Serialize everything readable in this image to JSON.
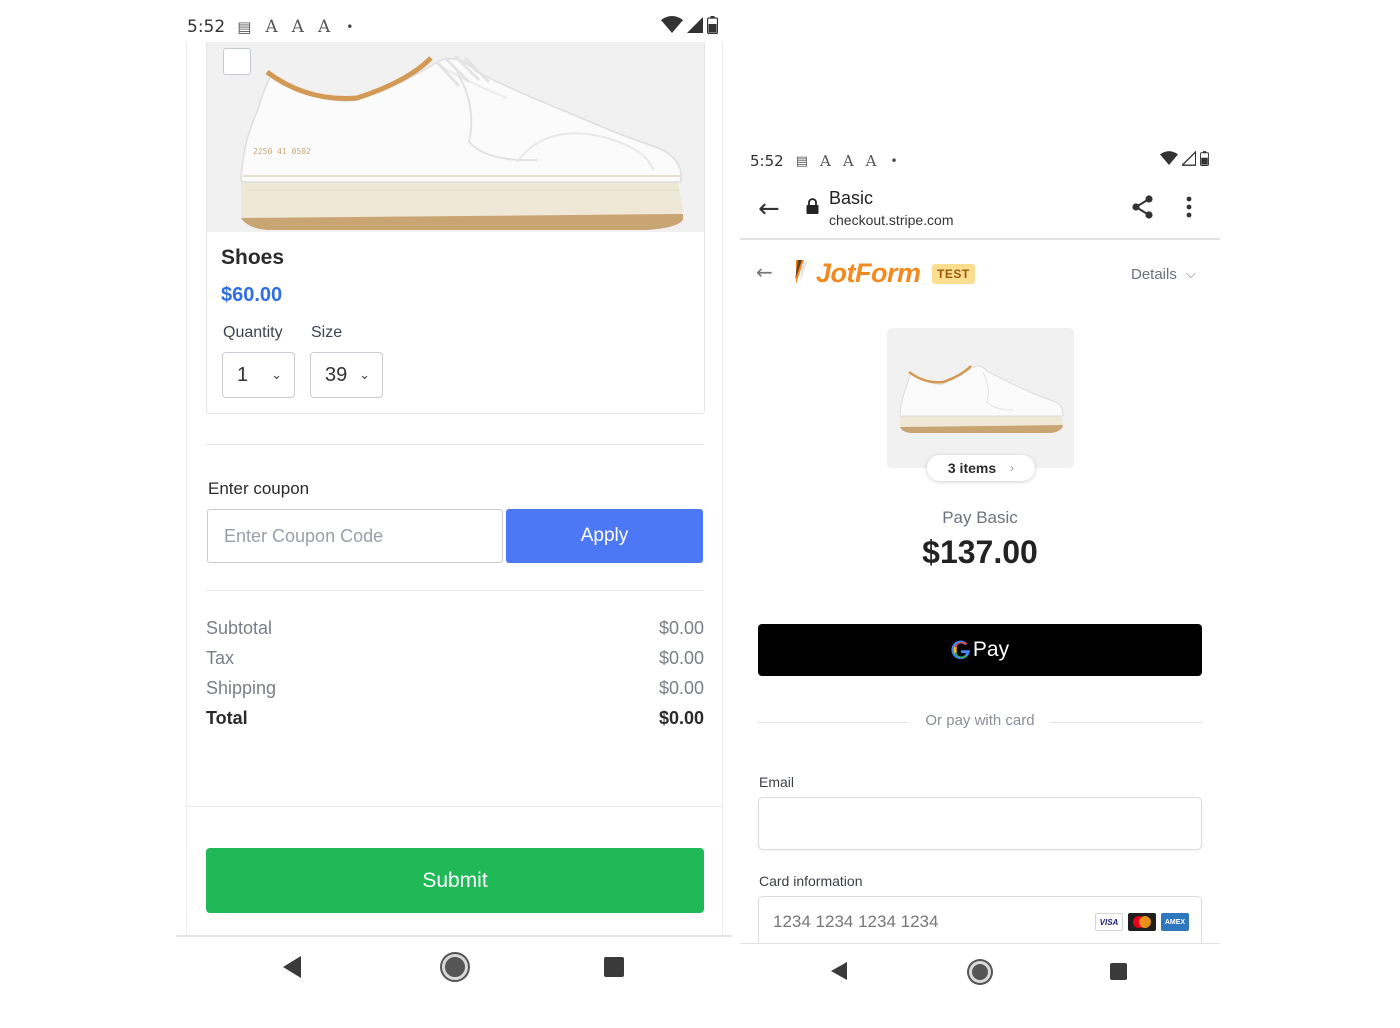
{
  "left_phone": {
    "status_bar": {
      "time": "5:52",
      "icons": [
        "message-icon",
        "font-icon",
        "font-icon",
        "font-icon",
        "dot-icon",
        "wifi-icon",
        "signal-icon",
        "battery-icon"
      ],
      "font_glyph": "A",
      "dot": "•"
    },
    "product": {
      "name": "Shoes",
      "price": "$60.00",
      "image_serial": "2250 41 0502",
      "quantity": {
        "label": "Quantity",
        "value": "1"
      },
      "size": {
        "label": "Size",
        "value": "39"
      }
    },
    "coupon": {
      "label": "Enter coupon",
      "placeholder": "Enter Coupon Code",
      "apply_label": "Apply"
    },
    "summary": [
      {
        "label": "Subtotal",
        "value": "$0.00"
      },
      {
        "label": "Tax",
        "value": "$0.00"
      },
      {
        "label": "Shipping",
        "value": "$0.00"
      }
    ],
    "total": {
      "label": "Total",
      "value": "$0.00"
    },
    "submit_label": "Submit"
  },
  "right_phone": {
    "status_bar": {
      "time": "5:52",
      "font_glyph": "A",
      "dot": "•"
    },
    "browser": {
      "title": "Basic",
      "url": "checkout.stripe.com",
      "back_glyph": "←"
    },
    "checkout": {
      "brand": "JotForm",
      "badge": "TEST",
      "details_label": "Details",
      "back_glyph": "←",
      "items_label": "3 items",
      "pay_label": "Pay Basic",
      "amount": "$137.00",
      "gpay_g": "G",
      "gpay_label": "Pay",
      "divider_text": "Or pay with card",
      "email_label": "Email",
      "card_label": "Card information",
      "card_placeholder": "1234 1234 1234 1234",
      "card_brands": [
        "VISA",
        "mastercard",
        "AMEX"
      ]
    }
  },
  "colors": {
    "price_blue": "#2f6ee5",
    "apply_blue": "#4c78f5",
    "submit_green": "#1fb957",
    "jotform_orange": "#f28a22",
    "test_badge": "#fbdd8f"
  }
}
